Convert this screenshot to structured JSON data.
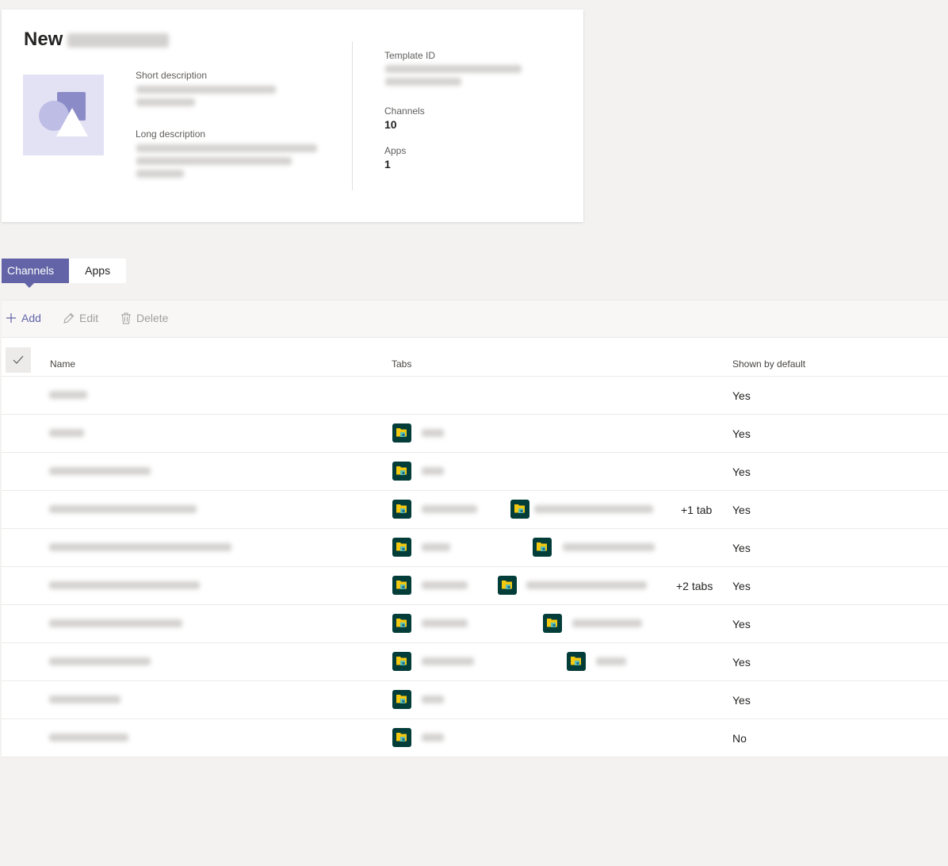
{
  "header": {
    "title_prefix": "New",
    "short_description_label": "Short description",
    "long_description_label": "Long description",
    "template_id_label": "Template ID",
    "channels_label": "Channels",
    "channels_count": "10",
    "apps_label": "Apps",
    "apps_count": "1"
  },
  "tabs": [
    {
      "label": "Channels",
      "active": true
    },
    {
      "label": "Apps",
      "active": false
    }
  ],
  "toolbar": {
    "add_label": "Add",
    "edit_label": "Edit",
    "delete_label": "Delete"
  },
  "grid": {
    "columns": {
      "name": "Name",
      "tabs": "Tabs",
      "shown_by_default": "Shown by default"
    },
    "rows": [
      {
        "shown": "Yes",
        "more_tabs": ""
      },
      {
        "shown": "Yes",
        "more_tabs": ""
      },
      {
        "shown": "Yes",
        "more_tabs": ""
      },
      {
        "shown": "Yes",
        "more_tabs": "+1 tab"
      },
      {
        "shown": "Yes",
        "more_tabs": ""
      },
      {
        "shown": "Yes",
        "more_tabs": "+2 tabs"
      },
      {
        "shown": "Yes",
        "more_tabs": ""
      },
      {
        "shown": "Yes",
        "more_tabs": ""
      },
      {
        "shown": "Yes",
        "more_tabs": ""
      },
      {
        "shown": "No",
        "more_tabs": ""
      }
    ]
  },
  "icons": {
    "tab_app": "files-app-icon",
    "add": "plus-icon",
    "edit": "pencil-icon",
    "delete": "trash-icon",
    "select_all": "checkmark-icon"
  },
  "colors": {
    "accent": "#6264a7",
    "tab_icon_bg": "#033d3a"
  }
}
